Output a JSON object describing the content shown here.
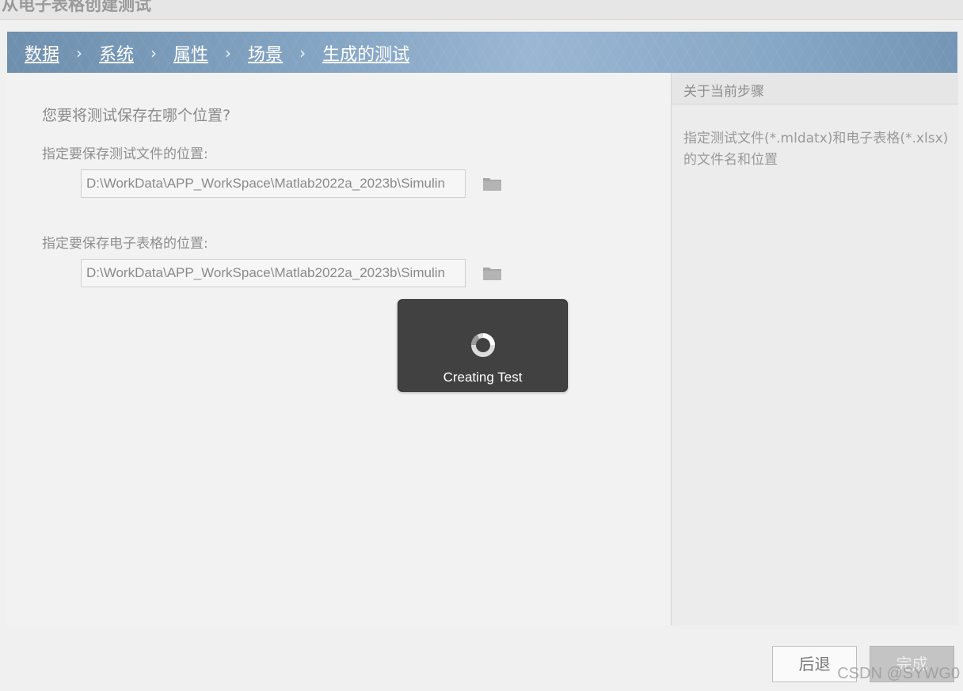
{
  "window": {
    "title": "从电子表格创建测试"
  },
  "breadcrumb": {
    "separator": "›",
    "items": [
      {
        "label": "数据"
      },
      {
        "label": "系统"
      },
      {
        "label": "属性"
      },
      {
        "label": "场景"
      },
      {
        "label": "生成的测试"
      }
    ]
  },
  "main": {
    "question": "您要将测试保存在哪个位置?",
    "test_file": {
      "label": "指定要保存测试文件的位置:",
      "value": "D:\\WorkData\\APP_WorkSpace\\Matlab2022a_2023b\\Simulin"
    },
    "spreadsheet": {
      "label": "指定要保存电子表格的位置:",
      "value": "D:\\WorkData\\APP_WorkSpace\\Matlab2022a_2023b\\Simulin"
    }
  },
  "progress": {
    "label": "Creating Test"
  },
  "side": {
    "header": "关于当前步骤",
    "description": "指定测试文件(*.mldatx)和电子表格(*.xlsx)的文件名和位置"
  },
  "footer": {
    "back_label": "后退",
    "finish_label": "完成"
  },
  "watermark": "CSDN @SYWG0",
  "icons": {
    "folder": "folder-icon",
    "close": "close-icon",
    "spinner": "loading-spinner-icon"
  },
  "colors": {
    "breadcrumb_bg": "#86a6c5",
    "spinner_bg": "#414141"
  }
}
